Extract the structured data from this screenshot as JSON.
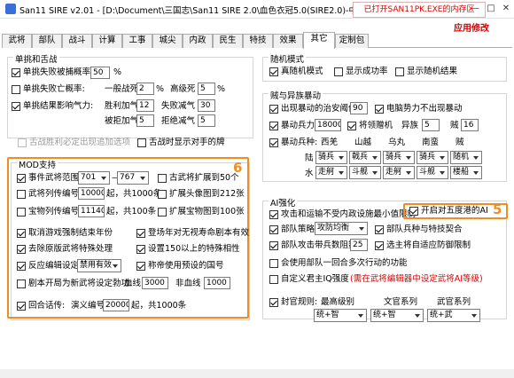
{
  "window": {
    "title": "San11 SIRE v2.01 - [D:\\Document\\三国志\\San11 SIRE 2.0\\血色衣冠5.0(SIRE2.0)-中级.sire]",
    "open_message": "已打开SAN11PK.EXE的内存区",
    "modify_label": "应用修改",
    "minimize": "—",
    "maximize": "□",
    "close": "✕"
  },
  "tabs": [
    "武将",
    "部队",
    "战斗",
    "计算",
    "工事",
    "城尖",
    "内政",
    "民生",
    "特技",
    "效果",
    "其它",
    "定制包"
  ],
  "left": {
    "single_title": "单挑和舌战",
    "single": {
      "fail_capture": "单挑失败被捕概率",
      "fail_capture_val": "50",
      "pct": "%",
      "fail_death": "单挑失败亡概率:",
      "general_death": "一般战死",
      "general_death_val": "2",
      "high_death": "高级死",
      "high_death_val": "5",
      "result_attr": "单挑结果影响气力:",
      "win_add": "胜利加气",
      "win_add_val": "12",
      "fail_reduce": "失败减气",
      "fail_reduce_val": "30",
      "refuse_add": "被拒加气",
      "refuse_add_val": "5",
      "refuse_reduce": "拒绝减气",
      "refuse_reduce_val": "5"
    },
    "debate_strategy": "舌战胜利必定出现追加选项",
    "debate_show": "舌战时显示对手的牌",
    "mod_title": "MOD支持",
    "event_range": "事件武将范围",
    "event_from": "701",
    "event_to": "767",
    "ancient_ext": "古武将扩展到50个",
    "general_id": "武将列传编号",
    "general_id_val": "10000",
    "start_label": "起，共1000条",
    "expand_portrait": "扩展头像图到212张",
    "treasure_id": "宝物列传编号",
    "treasure_id_val": "11140",
    "start_label2": "起，共100条",
    "expand_treasure": "扩展宝物图到100张",
    "cancel_event": "取消游戏强制结束年份",
    "title_change": "登场年对无视寿命剧本有效",
    "remove_clan": "去除原版武将特殊处理",
    "expand150": "设置150以上的特殊相性",
    "edit_counter": "反应编辑设定",
    "edit_counter_sel": "禁用有效",
    "custom_name": "称帝使用预设的国号",
    "rebuild_face": "剧本开局为新武将设定勃功:",
    "blood_line": "血线",
    "blood_line_val": "3000",
    "non_blood": "非血线",
    "non_blood_val": "1000",
    "back_history": "回合话传:",
    "cheat_id": "演义编号",
    "cheat_id_val": "20000",
    "cheat_count": "起，共1000条"
  },
  "right": {
    "random_title": "随机模式",
    "true_random": "真随机模式",
    "show_rate": "显示成功率",
    "show_result": "显示随机结果",
    "riot_title": "贼与异族暴动",
    "riot_security": "出现暴动的治安阈值",
    "riot_security_val": "90",
    "ai_no_riot": "电脑势力不出现暴动",
    "riot_troops": "暴动兵力",
    "riot_troops_val": "18000",
    "leader_troops": "将领赠机",
    "foreign": "异族",
    "foreign_val": "5",
    "bandit": "贼",
    "bandit_val": "16",
    "riot_units": "暴动兵种:",
    "tribes": [
      "西羌",
      "山越",
      "乌丸",
      "南蛮",
      "贼"
    ],
    "land": "陆",
    "land_vals": [
      "骑兵",
      "戟兵",
      "骑兵",
      "骑兵",
      "随机"
    ],
    "water": "水",
    "water_vals": [
      "走舸",
      "斗舰",
      "走舸",
      "斗舰",
      "楼船"
    ],
    "ai_title": "AI强化",
    "ai_attack": "攻击和运输不受内政设施最小值限制",
    "five_ai": "开启对五度港的AI",
    "deploy_strategy": "部队策略",
    "deploy_strategy_sel": "攻防均衡",
    "unit_tactics": "部队兵种与特技契合",
    "attack_general": "部队攻击带兵数阻数",
    "attack_general_val": "25",
    "select_defend": "选主将自适应防御限制",
    "merge_units": "会使用部队一回合多次行动的功能",
    "custom_king": "自定义君主IQ强度",
    "custom_king_note": "(需在武将编辑器中设定武将AI等级)",
    "seal_rank": "封官规则:",
    "best_rank": "最高级别",
    "civil": "文官系列",
    "military": "武官系列",
    "seal_vals": [
      "统+智",
      "统+智",
      "统+武"
    ]
  },
  "badges": {
    "five": "5",
    "six": "6"
  },
  "colors": {
    "highlight": "#f28c1e",
    "red": "#dd0000"
  }
}
